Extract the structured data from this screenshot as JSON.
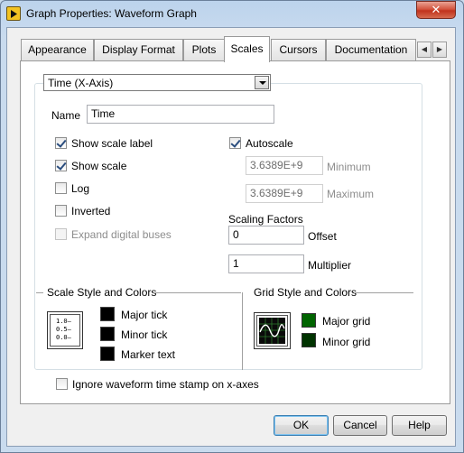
{
  "window": {
    "title": "Graph Properties: Waveform Graph",
    "close_label": "✕"
  },
  "tabs": [
    {
      "label": "Appearance"
    },
    {
      "label": "Display Format"
    },
    {
      "label": "Plots"
    },
    {
      "label": "Scales",
      "active": true
    },
    {
      "label": "Cursors"
    },
    {
      "label": "Documentation"
    }
  ],
  "axis_select": {
    "value": "Time (X-Axis)"
  },
  "name": {
    "label": "Name",
    "value": "Time"
  },
  "checkboxes": {
    "show_scale_label": {
      "label": "Show scale label",
      "checked": true
    },
    "show_scale": {
      "label": "Show scale",
      "checked": true
    },
    "log": {
      "label": "Log",
      "checked": false
    },
    "inverted": {
      "label": "Inverted",
      "checked": false
    },
    "expand_digital_buses": {
      "label": "Expand digital buses",
      "checked": false,
      "disabled": true
    },
    "autoscale": {
      "label": "Autoscale",
      "checked": true
    }
  },
  "range": {
    "minimum_value": "3.6389E+9",
    "minimum_label": "Minimum",
    "maximum_value": "3.6389E+9",
    "maximum_label": "Maximum"
  },
  "scaling_factors": {
    "title": "Scaling Factors",
    "offset_value": "0",
    "offset_label": "Offset",
    "multiplier_value": "1",
    "multiplier_label": "Multiplier"
  },
  "scale_style": {
    "title": "Scale Style and Colors",
    "icon_labels": [
      "1.0–",
      "0.5–",
      "0.0–"
    ],
    "major_tick_label": "Major tick",
    "minor_tick_label": "Minor tick",
    "marker_text_label": "Marker text"
  },
  "grid_style": {
    "title": "Grid Style and Colors",
    "major_grid_label": "Major grid",
    "minor_grid_label": "Minor grid"
  },
  "ignore_timestamp": {
    "label": "Ignore waveform time stamp on x-axes",
    "checked": false
  },
  "buttons": {
    "ok": "OK",
    "cancel": "Cancel",
    "help": "Help"
  },
  "colors": {
    "major_tick": "#000000",
    "minor_tick": "#000000",
    "marker_text": "#000000",
    "major_grid": "#006400",
    "minor_grid": "#003300"
  }
}
